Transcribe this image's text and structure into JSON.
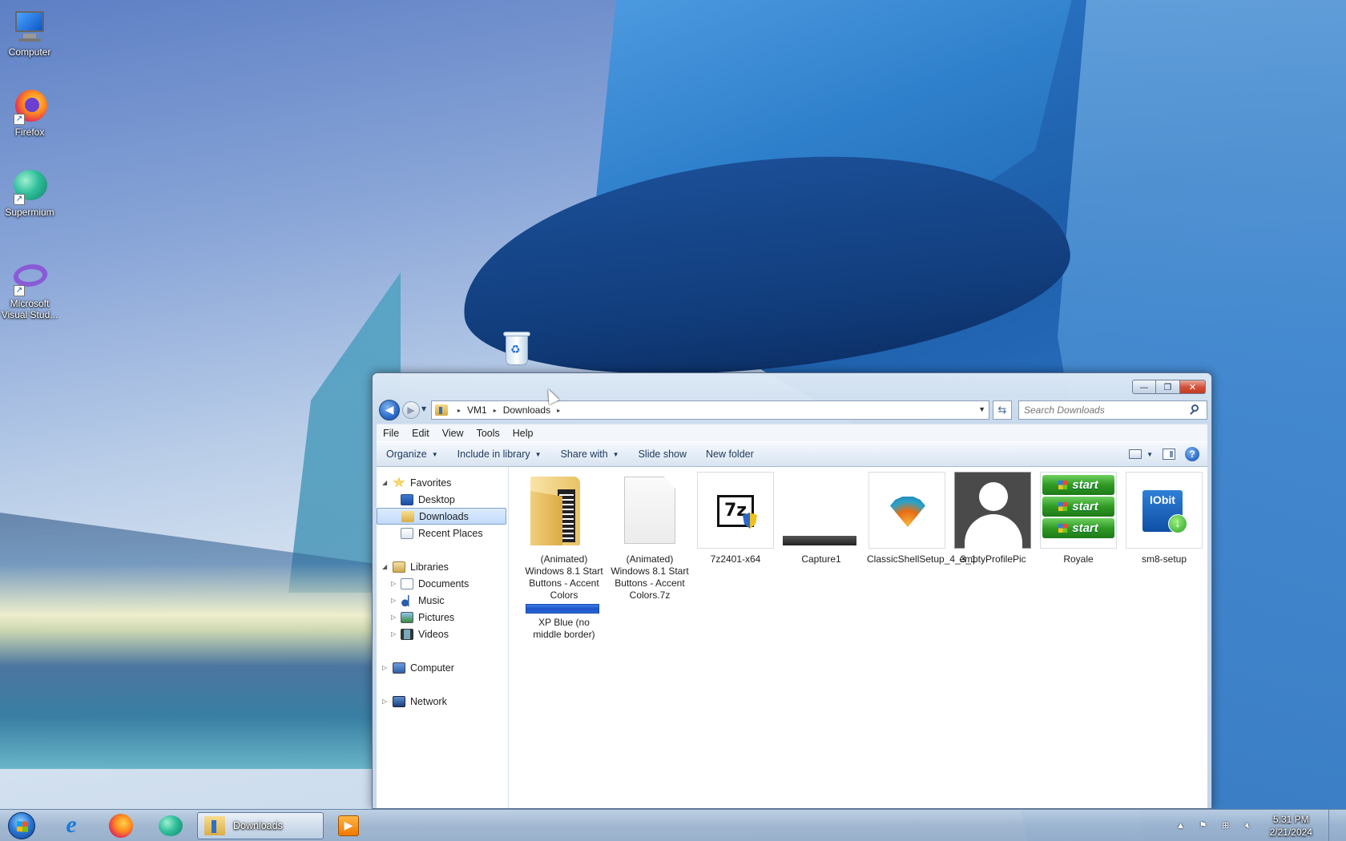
{
  "desktop": {
    "icons": [
      {
        "label": "Computer",
        "icon": "computer-icon"
      },
      {
        "label": "Firefox",
        "icon": "firefox-icon"
      },
      {
        "label": "Supermium",
        "icon": "supermium-icon"
      },
      {
        "label": "Microsoft Visual Stud...",
        "icon": "visual-studio-icon"
      }
    ],
    "recycle_bin_icon": "recycle-bin-icon"
  },
  "window": {
    "caption": {
      "minimize": "—",
      "maximize": "❐",
      "close": "✕"
    },
    "nav": {
      "back": "◀",
      "forward": "▶",
      "recent": "▼"
    },
    "address": {
      "segments": [
        "VM1",
        "Downloads"
      ],
      "separator": "▸",
      "dropdown": "▼",
      "refresh": "⇆"
    },
    "search": {
      "placeholder": "Search Downloads"
    },
    "menu": [
      "File",
      "Edit",
      "View",
      "Tools",
      "Help"
    ],
    "commands": [
      {
        "label": "Organize",
        "has_menu": true
      },
      {
        "label": "Include in library",
        "has_menu": true
      },
      {
        "label": "Share with",
        "has_menu": true
      },
      {
        "label": "Slide show",
        "has_menu": false
      },
      {
        "label": "New folder",
        "has_menu": false
      }
    ],
    "command_caret": "▼",
    "help_label": "?",
    "nav_pane": {
      "favorites": {
        "label": "Favorites",
        "items": [
          "Desktop",
          "Downloads",
          "Recent Places"
        ],
        "selected": "Downloads"
      },
      "libraries": {
        "label": "Libraries",
        "items": [
          "Documents",
          "Music",
          "Pictures",
          "Videos"
        ]
      },
      "computer": "Computer",
      "network": "Network",
      "expanded_arrow": "◢",
      "collapsed_arrow": "▷"
    },
    "files": [
      {
        "name": "(Animated) Windows 8.1 Start Buttons - Accent Colors",
        "kind": "folder"
      },
      {
        "name": "(Animated) Windows 8.1 Start Buttons - Accent Colors.7z",
        "kind": "blank-file"
      },
      {
        "name": "7z2401-x64",
        "kind": "7zip-installer"
      },
      {
        "name": "Capture1",
        "kind": "image-bar"
      },
      {
        "name": "ClassicShellSetup_4_3_1",
        "kind": "classic-shell-installer"
      },
      {
        "name": "emptyProfilePic",
        "kind": "profile-image"
      },
      {
        "name": "Royale",
        "kind": "royale-start-image"
      },
      {
        "name": "sm8-setup",
        "kind": "iobit-installer"
      },
      {
        "name": "XP Blue (no middle border)",
        "kind": "xp-blue-bar"
      }
    ],
    "royale_button_text": "start",
    "iobit_text": "IObit",
    "sevenzip_text": "7z",
    "download_arrow": "↓"
  },
  "taskbar": {
    "pinned": [
      "internet-explorer-icon",
      "firefox-icon",
      "supermium-icon",
      "media-player-icon"
    ],
    "ie_glyph": "e",
    "media_glyph": "▶",
    "active_window": "Downloads",
    "tray": {
      "up_arrow": "▲",
      "flag": "⚑",
      "network": "⊞",
      "volume": "🔇︎"
    },
    "clock": {
      "time": "5:31 PM",
      "date": "2/21/2024"
    }
  }
}
